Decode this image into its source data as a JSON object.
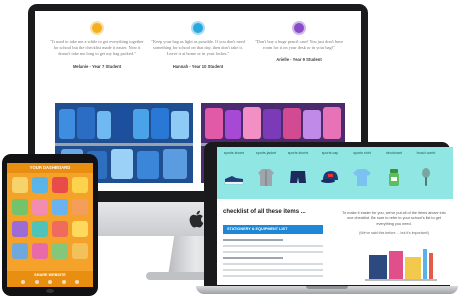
{
  "imac": {
    "testimonials": [
      {
        "quote": "\"It used to take me a while to get everything together for school but the checklist made it easier. Now it doesn't take me long to get my bag packed.\"",
        "author": "Melanie - Year 7 Student",
        "avatar_color": "#f2b01e"
      },
      {
        "quote": "\"Keep your bag as light as possible. If you don't need something for school on that day, then don't take it. Leave it at home or in your locker.\"",
        "author": "Hannah - Year 10 Student",
        "avatar_color": "#29a8e0"
      },
      {
        "quote": "\"Don't buy a huge pencil case! You just don't have room for it on your desk or in your bag!\"",
        "author": "Arielle - Year 9 Student",
        "avatar_color": "#8a4bc9"
      }
    ]
  },
  "laptop": {
    "kit_items": [
      {
        "label": "sports shoes",
        "icon": "sneaker-icon"
      },
      {
        "label": "sports jacket",
        "icon": "jacket-icon"
      },
      {
        "label": "sports shorts",
        "icon": "shorts-icon"
      },
      {
        "label": "sports cap",
        "icon": "cap-icon"
      },
      {
        "label": "sports shirt",
        "icon": "shirt-icon"
      },
      {
        "label": "deodorant",
        "icon": "deodorant-icon"
      },
      {
        "label": "brush comb",
        "icon": "brush-icon"
      }
    ],
    "checklist_title": "checklist of all these items ...",
    "download_banner": "STATIONERY & EQUIPMENT LIST",
    "download_text": "To make it easier for you, we've put all of the items above into one checklist. Be sure to refer to your school's list to get everything you need.",
    "download_note": "(We've said this before ... but it's important!)"
  },
  "tablet": {
    "header": "YOUR DASHBOARD",
    "footer": "SHARE WEBSITE",
    "apps": [
      "#f7d36b",
      "#5ab4ea",
      "#e94b4b",
      "#fcd34d",
      "#73c36b",
      "#f28cb1",
      "#6ab3f0",
      "#f59e5c",
      "#9c6bd6",
      "#4fc3b9",
      "#ef6b5e",
      "#ffd95e",
      "#6fa8dc",
      "#e86aa8",
      "#84c77a",
      "#f3c15a"
    ]
  },
  "colors": {
    "imac_photo_left": "#1f4f91",
    "imac_photo_right": "#4b2a6e",
    "kit_banner": "#8fe6e2",
    "download_banner": "#1e88d6",
    "tablet_bg": "#f4a22a"
  }
}
